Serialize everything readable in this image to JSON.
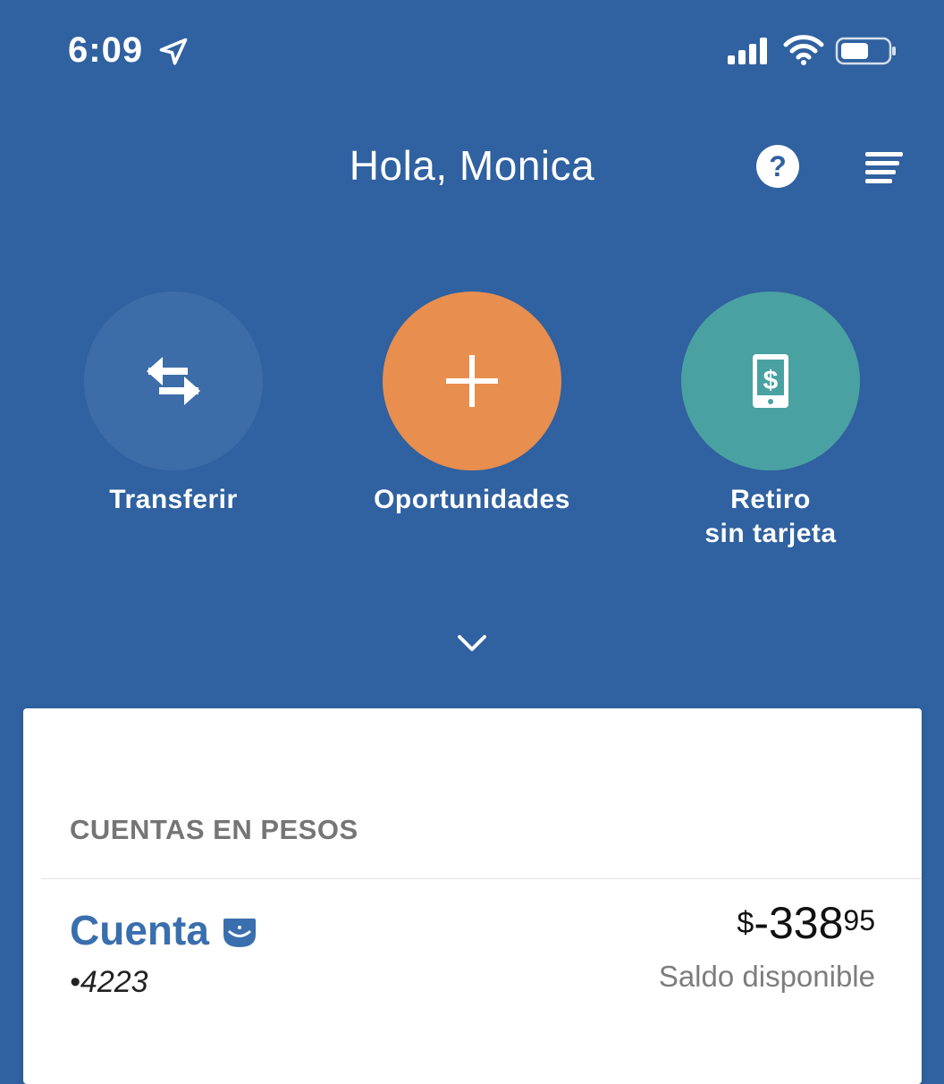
{
  "status_bar": {
    "time": "6:09"
  },
  "header": {
    "greeting": "Hola, Monica",
    "help_label": "?"
  },
  "actions": [
    {
      "label": "Transferir",
      "icon": "transfer-arrows-icon",
      "color": "#3d6da8"
    },
    {
      "label": "Oportunidades",
      "icon": "plus-icon",
      "color": "#e88e4e"
    },
    {
      "label_line1": "Retiro",
      "label_line2": "sin tarjeta",
      "icon": "phone-dollar-icon",
      "color": "#4aa1a2"
    }
  ],
  "accounts": {
    "section_title": "CUENTAS EN PESOS",
    "items": [
      {
        "name": "Cuenta",
        "number": "•4223",
        "currency": "$",
        "amount_main": "-338",
        "amount_cents": "95",
        "caption": "Saldo disponible"
      }
    ]
  },
  "colors": {
    "background": "#3061a0",
    "account_name": "#3a6fae"
  }
}
